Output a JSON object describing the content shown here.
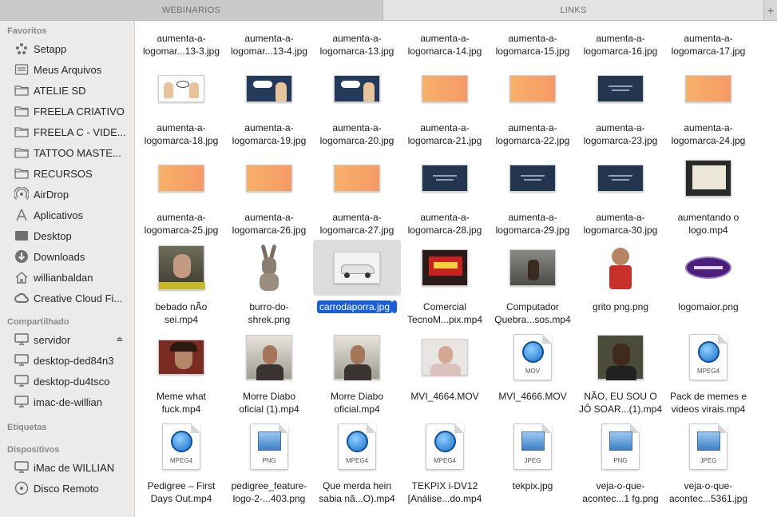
{
  "tabs": [
    {
      "label": "WEBINARIOS"
    },
    {
      "label": "LINKS"
    }
  ],
  "sidebar": {
    "favorites_title": "Favoritos",
    "favorites": [
      {
        "label": "Setapp",
        "icon": "setapp-icon"
      },
      {
        "label": "Meus Arquivos",
        "icon": "documents-icon"
      },
      {
        "label": "ATELIE SD",
        "icon": "folder-icon"
      },
      {
        "label": "FREELA CRIATIVO",
        "icon": "folder-icon"
      },
      {
        "label": "FREELA C - VIDE...",
        "icon": "folder-icon"
      },
      {
        "label": "TATTOO MASTE...",
        "icon": "folder-icon"
      },
      {
        "label": "RECURSOS",
        "icon": "folder-icon"
      },
      {
        "label": "AirDrop",
        "icon": "airdrop-icon"
      },
      {
        "label": "Aplicativos",
        "icon": "applications-icon"
      },
      {
        "label": "Desktop",
        "icon": "desktop-icon"
      },
      {
        "label": "Downloads",
        "icon": "downloads-icon"
      },
      {
        "label": "willianbaldan",
        "icon": "home-icon"
      },
      {
        "label": "Creative Cloud Fi...",
        "icon": "creative-cloud-icon"
      }
    ],
    "shared_title": "Compartilhado",
    "shared": [
      {
        "label": "servidor",
        "icon": "server-icon"
      },
      {
        "label": "desktop-ded84n3",
        "icon": "pc-icon"
      },
      {
        "label": "desktop-du4tsco",
        "icon": "pc-icon"
      },
      {
        "label": "imac-de-willian",
        "icon": "pc-icon"
      }
    ],
    "tags_title": "Etiquetas",
    "devices_title": "Dispositivos",
    "devices": [
      {
        "label": "iMac de WILLIAN",
        "icon": "imac-icon"
      },
      {
        "label": "Disco Remoto",
        "icon": "disc-icon"
      }
    ]
  },
  "files": [
    {
      "l1": "aumenta-a-",
      "l2": "logomar...13-3.jpg",
      "kind": "none"
    },
    {
      "l1": "aumenta-a-",
      "l2": "logomar...13-4.jpg",
      "kind": "none"
    },
    {
      "l1": "aumenta-a-",
      "l2": "logomarca-13.jpg",
      "kind": "none"
    },
    {
      "l1": "aumenta-a-",
      "l2": "logomarca-14.jpg",
      "kind": "none"
    },
    {
      "l1": "aumenta-a-",
      "l2": "logomarca-15.jpg",
      "kind": "none"
    },
    {
      "l1": "aumenta-a-",
      "l2": "logomarca-16.jpg",
      "kind": "none"
    },
    {
      "l1": "aumenta-a-",
      "l2": "logomarca-17.jpg",
      "kind": "none"
    },
    {
      "l1": "aumenta-a-",
      "l2": "logomarca-18.jpg",
      "kind": "cartoon-white"
    },
    {
      "l1": "aumenta-a-",
      "l2": "logomarca-19.jpg",
      "kind": "cartoon-dark"
    },
    {
      "l1": "aumenta-a-",
      "l2": "logomarca-20.jpg",
      "kind": "cartoon-dark"
    },
    {
      "l1": "aumenta-a-",
      "l2": "logomarca-21.jpg",
      "kind": "slide-orange"
    },
    {
      "l1": "aumenta-a-",
      "l2": "logomarca-22.jpg",
      "kind": "slide-orange"
    },
    {
      "l1": "aumenta-a-",
      "l2": "logomarca-23.jpg",
      "kind": "slide-dark"
    },
    {
      "l1": "aumenta-a-",
      "l2": "logomarca-24.jpg",
      "kind": "slide-orange"
    },
    {
      "l1": "aumenta-a-",
      "l2": "logomarca-25.jpg",
      "kind": "slide-orange"
    },
    {
      "l1": "aumenta-a-",
      "l2": "logomarca-26.jpg",
      "kind": "slide-orange"
    },
    {
      "l1": "aumenta-a-",
      "l2": "logomarca-27.jpg",
      "kind": "slide-orange"
    },
    {
      "l1": "aumenta-a-",
      "l2": "logomarca-28.jpg",
      "kind": "slide-dark"
    },
    {
      "l1": "aumenta-a-",
      "l2": "logomarca-29.jpg",
      "kind": "slide-dark"
    },
    {
      "l1": "aumenta-a-",
      "l2": "logomarca-30.jpg",
      "kind": "slide-dark"
    },
    {
      "l1": "aumentando o",
      "l2": "logo.mp4",
      "kind": "video-certificate"
    },
    {
      "l1": "bebado nÃo",
      "l2": "sei.mp4",
      "kind": "video-man"
    },
    {
      "l1": "burro-do-",
      "l2": "shrek.png",
      "kind": "donkey"
    },
    {
      "l1": "carrodaporra.jpg",
      "l2": "",
      "kind": "car",
      "selected": true
    },
    {
      "l1": "Comercial",
      "l2": "TecnoM...pix.mp4",
      "kind": "video-promo"
    },
    {
      "l1": "Computador",
      "l2": "Quebra...sos.mp4",
      "kind": "video-room"
    },
    {
      "l1": "grito png.png",
      "l2": "",
      "kind": "shout"
    },
    {
      "l1": "logomaior.png",
      "l2": "",
      "kind": "logo-purple"
    },
    {
      "l1": "Meme what",
      "l2": "fuck.mp4",
      "kind": "video-meme"
    },
    {
      "l1": "Morre Diabo",
      "l2": "oficial (1).mp4",
      "kind": "video-person"
    },
    {
      "l1": "Morre Diabo",
      "l2": "oficial.mp4",
      "kind": "video-person"
    },
    {
      "l1": "MVI_4664.MOV",
      "l2": "",
      "kind": "video-face"
    },
    {
      "l1": "MVI_4666.MOV",
      "l2": "",
      "kind": "doc-mov",
      "tag": "MOV"
    },
    {
      "l1": "NÃO, EU SOU O",
      "l2": "JÔ SOAR...(1).mp4",
      "kind": "video-jo"
    },
    {
      "l1": "Pack de memes e",
      "l2": "videos virais.mp4",
      "kind": "doc-mov",
      "tag": "MPEG4"
    },
    {
      "l1": "Pedigree – First",
      "l2": "Days Out.mp4",
      "kind": "doc-mov",
      "tag": "MPEG4"
    },
    {
      "l1": "pedigree_feature-",
      "l2": "logo-2-...403.png",
      "kind": "doc-png",
      "tag": "PNG"
    },
    {
      "l1": "Que merda hein",
      "l2": "sabia nã...O).mp4",
      "kind": "doc-mov",
      "tag": "MPEG4"
    },
    {
      "l1": "TEKPIX i-DV12",
      "l2": "[Análise...do.mp4",
      "kind": "doc-mov",
      "tag": "MPEG4"
    },
    {
      "l1": "tekpix.jpg",
      "l2": "",
      "kind": "doc-png",
      "tag": "JPEG"
    },
    {
      "l1": "veja-o-que-",
      "l2": "acontec...1 fg.png",
      "kind": "doc-png",
      "tag": "PNG"
    },
    {
      "l1": "veja-o-que-",
      "l2": "acontec...5361.jpg",
      "kind": "doc-png",
      "tag": "JPEG"
    }
  ]
}
